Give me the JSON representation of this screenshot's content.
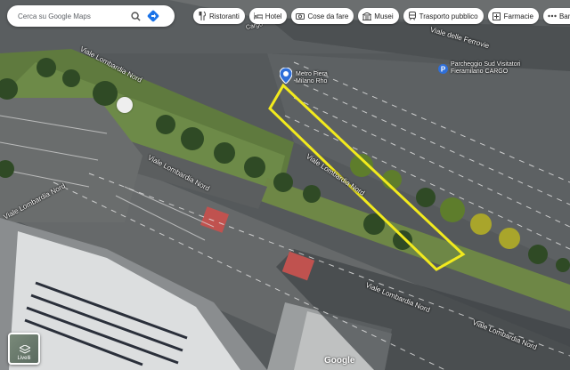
{
  "search": {
    "placeholder": "Cerca su Google Maps"
  },
  "chips": [
    {
      "label": "Ristoranti",
      "icon": "fork-knife-icon"
    },
    {
      "label": "Hotel",
      "icon": "bed-icon"
    },
    {
      "label": "Cose da fare",
      "icon": "camera-icon"
    },
    {
      "label": "Musei",
      "icon": "museum-icon"
    },
    {
      "label": "Trasporto pubblico",
      "icon": "train-icon"
    },
    {
      "label": "Farmacie",
      "icon": "pharmacy-icon"
    },
    {
      "label": "Bancomat",
      "icon": "atm-icon"
    }
  ],
  "places": {
    "metro_line1": "Metro Fiera",
    "metro_line2": "Milano Rho",
    "parking_line1": "Parcheggio Sud Visitatori",
    "parking_line2": "Fieramilano CARGO"
  },
  "roads": {
    "ferrovia": "Viale delle Ferrovie",
    "lombardia_1": "Viale Lombardia Nord",
    "lombardia_2": "Viale Lombardia Nord",
    "lombardia_3": "Viale Lombardia Nord",
    "lombardia_4": "Viale Lombardia Nord",
    "cargo": "Cargo"
  },
  "layers_label": "Livelli",
  "attribution": "Google",
  "colors": {
    "highlight": "#f2ea1d",
    "pin": "#2f6fd8"
  }
}
